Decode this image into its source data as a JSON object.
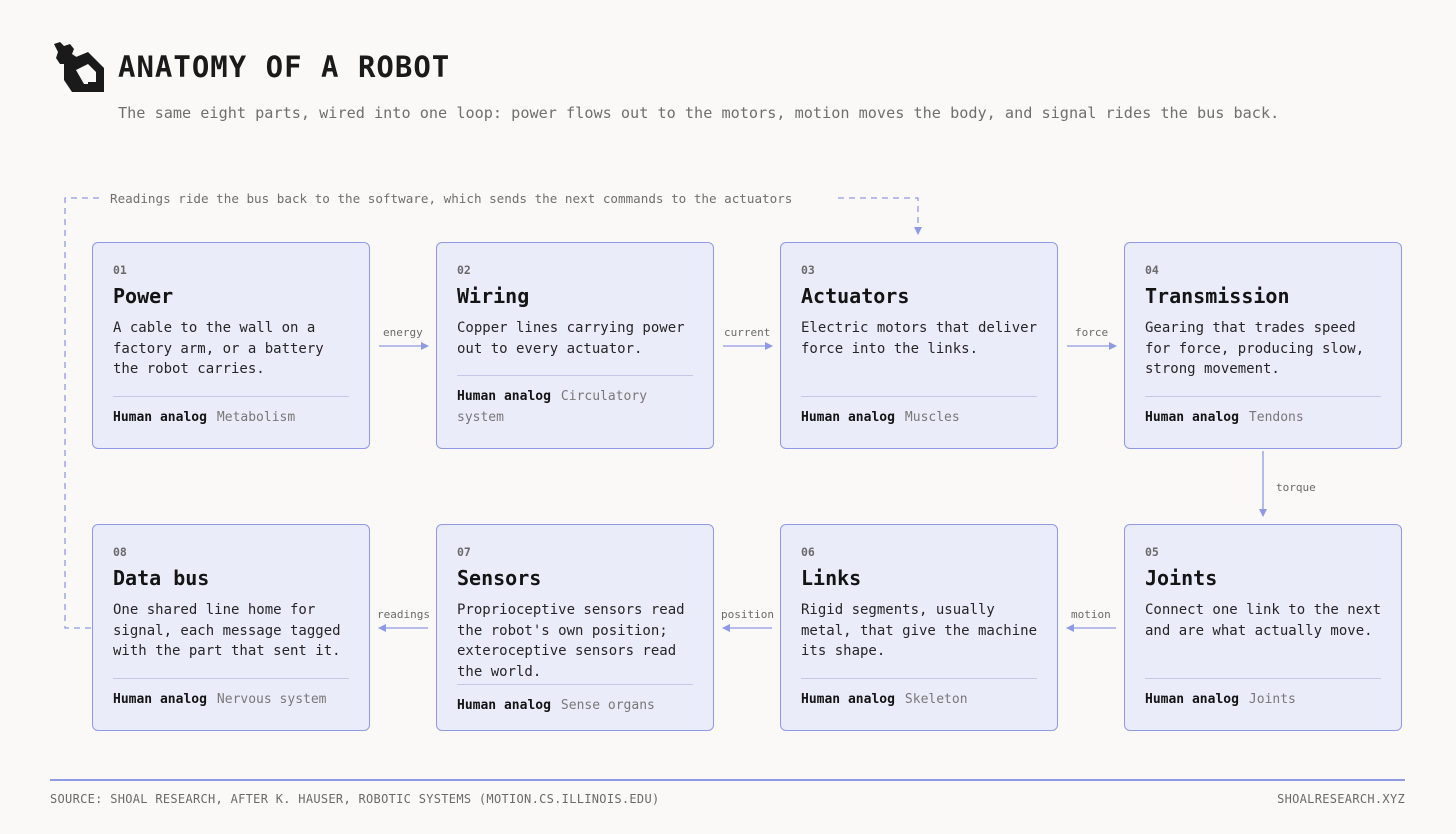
{
  "header": {
    "title": "ANATOMY OF A ROBOT",
    "subtitle": "The same eight parts, wired into one loop: power flows out to the motors, motion moves the body, and signal rides the bus back."
  },
  "loop_label": "Readings ride the bus back to the software, which sends the next commands to the actuators",
  "footer": {
    "source": "SOURCE: SHOAL RESEARCH, AFTER K. HAUSER, ROBOTIC SYSTEMS (MOTION.CS.ILLINOIS.EDU)",
    "site": "SHOALRESEARCH.XYZ"
  },
  "analog_key": "Human analog",
  "parts": [
    {
      "num": "01",
      "name": "Power",
      "desc": "A cable to the wall on a factory arm, or a battery the robot carries.",
      "analog": "Metabolism"
    },
    {
      "num": "02",
      "name": "Wiring",
      "desc": "Copper lines carrying power out to every actuator.",
      "analog": "Circulatory system"
    },
    {
      "num": "03",
      "name": "Actuators",
      "desc": "Electric motors that deliver force into the links.",
      "analog": "Muscles"
    },
    {
      "num": "04",
      "name": "Transmission",
      "desc": "Gearing that trades speed for force, producing slow, strong movement.",
      "analog": "Tendons"
    },
    {
      "num": "05",
      "name": "Joints",
      "desc": "Connect one link to the next and are what actually move.",
      "analog": "Joints"
    },
    {
      "num": "06",
      "name": "Links",
      "desc": "Rigid segments, usually metal, that give the machine its shape.",
      "analog": "Skeleton"
    },
    {
      "num": "07",
      "name": "Sensors",
      "desc": "Proprioceptive sensors read the robot's own position; exteroceptive sensors read the world.",
      "analog": "Sense organs"
    },
    {
      "num": "08",
      "name": "Data bus",
      "desc": "One shared line home for signal, each message tagged with the part that sent it.",
      "analog": "Nervous system"
    }
  ],
  "edges": [
    "energy",
    "current",
    "force",
    "torque",
    "motion",
    "position",
    "readings"
  ],
  "colors": {
    "accent": "#8f9ae6",
    "card_fill": "#eaecfa",
    "background": "#faf9f7"
  }
}
